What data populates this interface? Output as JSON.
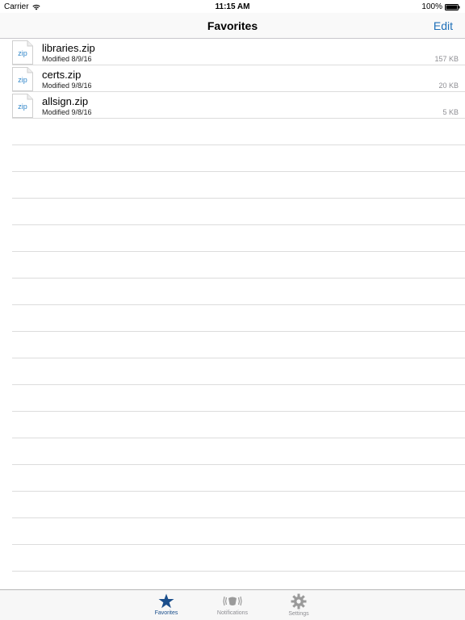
{
  "status_bar": {
    "carrier": "Carrier",
    "time": "11:15 AM",
    "battery": "100%"
  },
  "nav": {
    "title": "Favorites",
    "edit_label": "Edit"
  },
  "files": [
    {
      "icon_label": "zip",
      "name": "libraries.zip",
      "modified": "Modified 8/9/16",
      "size": "157 KB"
    },
    {
      "icon_label": "zip",
      "name": "certs.zip",
      "modified": "Modified 9/8/16",
      "size": "20 KB"
    },
    {
      "icon_label": "zip",
      "name": "allsign.zip",
      "modified": "Modified 9/8/16",
      "size": "5 KB"
    }
  ],
  "tabs": [
    {
      "label": "Favorites",
      "icon": "star-icon",
      "active": true
    },
    {
      "label": "Notifications",
      "icon": "vibrate-icon",
      "active": false
    },
    {
      "label": "Settings",
      "icon": "gear-icon",
      "active": false
    }
  ],
  "colors": {
    "accent": "#1e6fb8",
    "active_tab": "#1b4f8c",
    "inactive_tab": "#8e8e93"
  }
}
